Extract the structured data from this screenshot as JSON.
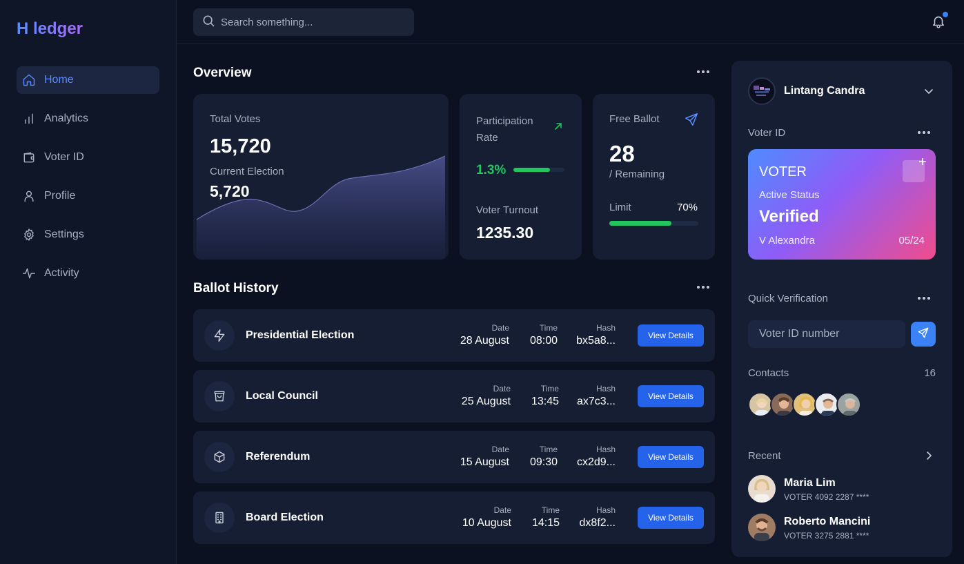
{
  "app": {
    "logo": "H ledger"
  },
  "sidebar": {
    "items": [
      {
        "label": "Home",
        "icon": "home-icon",
        "active": true
      },
      {
        "label": "Analytics",
        "icon": "bar-chart-icon"
      },
      {
        "label": "Voter ID",
        "icon": "wallet-icon"
      },
      {
        "label": "Profile",
        "icon": "user-icon"
      },
      {
        "label": "Settings",
        "icon": "gear-icon"
      },
      {
        "label": "Activity",
        "icon": "activity-icon"
      }
    ]
  },
  "topbar": {
    "search_placeholder": "Search something..."
  },
  "overview": {
    "title": "Overview",
    "total_votes_label": "Total Votes",
    "total_votes": "15,720",
    "current_election_label": "Current Election",
    "current_election": "5,720",
    "participation_label": "Participation Rate",
    "participation_rate": "1.3%",
    "participation_fill": 0.72,
    "turnout_label": "Voter Turnout",
    "turnout_value": "1235.30",
    "free_ballot_label": "Free Ballot",
    "free_ballot_value": "28",
    "remaining_label": "/ Remaining",
    "limit_label": "Limit",
    "limit_value": "70%",
    "limit_fill": 0.7
  },
  "ballot_history": {
    "title": "Ballot History",
    "headers": {
      "date": "Date",
      "time": "Time",
      "hash": "Hash"
    },
    "button_label": "View Details",
    "rows": [
      {
        "name": "Presidential Election",
        "icon": "lightning-icon",
        "date": "28 August",
        "time": "08:00",
        "hash": "bx5a8..."
      },
      {
        "name": "Local Council",
        "icon": "shopping-bag-icon",
        "date": "25 August",
        "time": "13:45",
        "hash": "ax7c3..."
      },
      {
        "name": "Referendum",
        "icon": "cube-icon",
        "date": "15 August",
        "time": "09:30",
        "hash": "cx2d9..."
      },
      {
        "name": "Board Election",
        "icon": "building-icon",
        "date": "10 August",
        "time": "14:15",
        "hash": "dx8f2..."
      }
    ]
  },
  "profile": {
    "name": "Lintang Candra",
    "voter_id_label": "Voter ID",
    "card": {
      "title": "VOTER",
      "status_label": "Active Status",
      "status": "Verified",
      "holder": "V Alexandra",
      "expiry": "05/24"
    },
    "quick_verification_label": "Quick Verification",
    "voter_id_placeholder": "Voter ID number",
    "contacts_label": "Contacts",
    "contacts_count": "16",
    "recent_label": "Recent",
    "recent": [
      {
        "name": "Maria Lim",
        "sub": "VOTER 4092 2287 ****"
      },
      {
        "name": "Roberto Mancini",
        "sub": "VOTER 3275 2881 ****"
      }
    ]
  },
  "colors": {
    "accent": "#3b82f6",
    "positive": "#22c55e",
    "background": "#0b1120",
    "card": "#151e33"
  }
}
